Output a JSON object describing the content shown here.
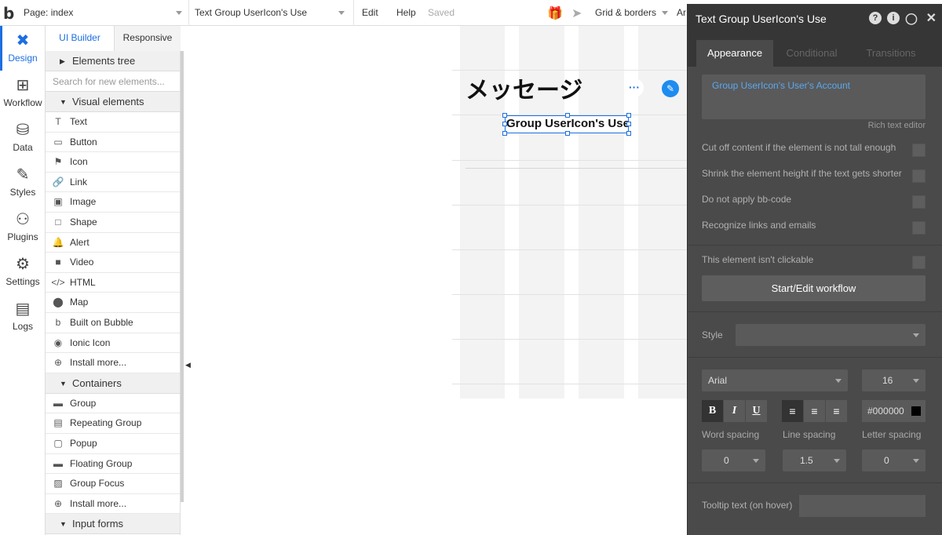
{
  "topbar": {
    "logo": "b",
    "page_selector": "Page: index",
    "element_selector": "Text Group UserIcon's Use",
    "edit": "Edit",
    "help": "Help",
    "saved": "Saved",
    "grid_borders": "Grid & borders",
    "arrange": "Ar"
  },
  "leftnav": [
    {
      "label": "Design",
      "icon": "design-icon"
    },
    {
      "label": "Workflow",
      "icon": "workflow-icon"
    },
    {
      "label": "Data",
      "icon": "data-icon"
    },
    {
      "label": "Styles",
      "icon": "styles-icon"
    },
    {
      "label": "Plugins",
      "icon": "plugins-icon"
    },
    {
      "label": "Settings",
      "icon": "settings-icon"
    },
    {
      "label": "Logs",
      "icon": "logs-icon"
    }
  ],
  "palette": {
    "tabs": {
      "ui_builder": "UI Builder",
      "responsive": "Responsive"
    },
    "elements_tree": "Elements tree",
    "search_placeholder": "Search for new elements...",
    "visual_section": "Visual elements",
    "visual_items": [
      {
        "label": "Text",
        "glyph": "T"
      },
      {
        "label": "Button",
        "glyph": "▭"
      },
      {
        "label": "Icon",
        "glyph": "⚑"
      },
      {
        "label": "Link",
        "glyph": "🔗"
      },
      {
        "label": "Image",
        "glyph": "▣"
      },
      {
        "label": "Shape",
        "glyph": "□"
      },
      {
        "label": "Alert",
        "glyph": "🔔"
      },
      {
        "label": "Video",
        "glyph": "■"
      },
      {
        "label": "HTML",
        "glyph": "</>"
      },
      {
        "label": "Map",
        "glyph": "⬤"
      },
      {
        "label": "Built on Bubble",
        "glyph": "b"
      },
      {
        "label": "Ionic Icon",
        "glyph": "◉"
      },
      {
        "label": "Install more...",
        "glyph": "⊕"
      }
    ],
    "containers_section": "Containers",
    "container_items": [
      {
        "label": "Group",
        "glyph": "▬"
      },
      {
        "label": "Repeating Group",
        "glyph": "▤"
      },
      {
        "label": "Popup",
        "glyph": "▢"
      },
      {
        "label": "Floating Group",
        "glyph": "▬"
      },
      {
        "label": "Group Focus",
        "glyph": "▨"
      },
      {
        "label": "Install more...",
        "glyph": "⊕"
      }
    ],
    "input_section": "Input forms"
  },
  "canvas": {
    "title": "メッセージ",
    "selected_text": "Group UserIcon's User's Account's email",
    "dots": "···",
    "edit_badge": "✎"
  },
  "panel": {
    "title": "Text Group UserIcon's Use",
    "tabs": [
      "Appearance",
      "Conditional",
      "Transitions"
    ],
    "rich_text": "Group UserIcon's User's Account",
    "rich_text_editor": "Rich text editor",
    "options": [
      "Cut off content if the element is not tall enough",
      "Shrink the element height if the text gets shorter",
      "Do not apply bb-code",
      "Recognize links and emails"
    ],
    "not_clickable": "This element isn't clickable",
    "workflow_button": "Start/Edit workflow",
    "style_label": "Style",
    "style_value": "",
    "font": "Arial",
    "font_size": "16",
    "bold": "B",
    "italic": "I",
    "underline": "U",
    "align_left": "≡",
    "align_center": "≡",
    "align_right": "≡",
    "color": "#000000",
    "word_spacing_label": "Word spacing",
    "line_spacing_label": "Line spacing",
    "letter_spacing_label": "Letter spacing",
    "word_spacing": "0",
    "line_spacing": "1.5",
    "letter_spacing": "0",
    "tooltip_label": "Tooltip text (on hover)",
    "tooltip_value": ""
  }
}
